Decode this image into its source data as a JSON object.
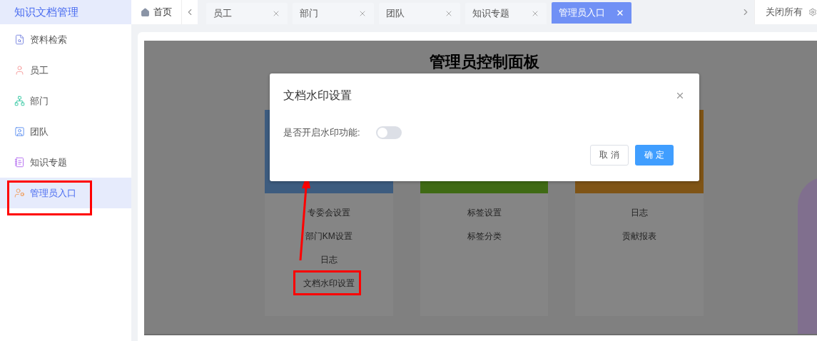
{
  "sidebar": {
    "title": "知识文档管理",
    "items": [
      {
        "label": "资料检索",
        "kind": "search",
        "selected": false,
        "annotated": false
      },
      {
        "label": "员工",
        "kind": "person",
        "selected": false,
        "annotated": false
      },
      {
        "label": "部门",
        "kind": "org",
        "selected": false,
        "annotated": false
      },
      {
        "label": "团队",
        "kind": "team",
        "selected": false,
        "annotated": false
      },
      {
        "label": "知识专题",
        "kind": "topic",
        "selected": false,
        "annotated": false
      },
      {
        "label": "管理员入口",
        "kind": "admin",
        "selected": true,
        "annotated": true
      }
    ]
  },
  "tabbar": {
    "home": "首页",
    "close_all": "关闭所有",
    "tabs": [
      {
        "label": "员工",
        "selected": false
      },
      {
        "label": "部门",
        "selected": false
      },
      {
        "label": "团队",
        "selected": false
      },
      {
        "label": "知识专题",
        "selected": false
      },
      {
        "label": "管理员入口",
        "selected": true
      }
    ]
  },
  "panel": {
    "title": "管理员控制面板",
    "cards": [
      {
        "color": "#3d5c7f",
        "items": [
          {
            "label": "专委会设置",
            "annotated": false
          },
          {
            "label": "部门KM设置",
            "annotated": false
          },
          {
            "label": "日志",
            "annotated": false
          },
          {
            "label": "文档水印设置",
            "annotated": true
          }
        ]
      },
      {
        "color": "#3f6a14",
        "items": [
          {
            "label": "标签设置",
            "annotated": false
          },
          {
            "label": "标签分类",
            "annotated": false
          }
        ]
      },
      {
        "color": "#7f5416",
        "items": [
          {
            "label": "日志",
            "annotated": false
          },
          {
            "label": "贡献报表",
            "annotated": false
          }
        ]
      }
    ]
  },
  "dialog": {
    "title": "文档水印设置",
    "field_label": "是否开启水印功能:",
    "on": false,
    "buttons": [
      {
        "label": "取 消",
        "kind": "secondary"
      },
      {
        "label": "确 定",
        "kind": "primary"
      }
    ]
  }
}
